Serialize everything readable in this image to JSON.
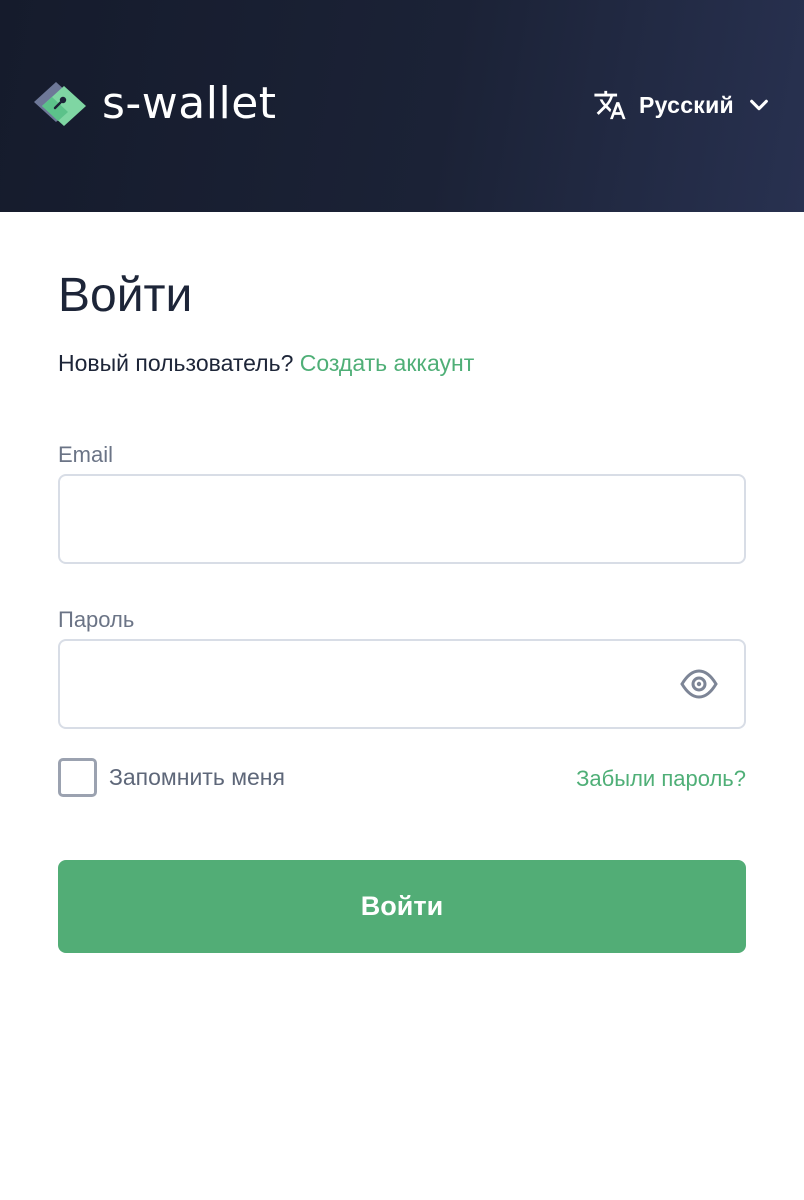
{
  "header": {
    "brand": "s-wallet",
    "logo_icon": "wallet-logo-icon",
    "language": {
      "icon": "translate-icon",
      "label": "Русский",
      "chevron": "chevron-down-icon"
    }
  },
  "login": {
    "title": "Войти",
    "signup_prompt": "Новый пользователь?",
    "signup_link": "Создать аккаунт",
    "email": {
      "label": "Email",
      "value": ""
    },
    "password": {
      "label": "Пароль",
      "value": "",
      "toggle_icon": "eye-icon"
    },
    "remember_label": "Запомнить меня",
    "remember_checked": false,
    "forgot_link": "Забыли пароль?",
    "submit_label": "Войти"
  },
  "colors": {
    "header_bg": "#1b2236",
    "accent": "#52ad76",
    "link": "#4faf77",
    "text_dark": "#1d2538",
    "text_muted": "#6b7486"
  }
}
